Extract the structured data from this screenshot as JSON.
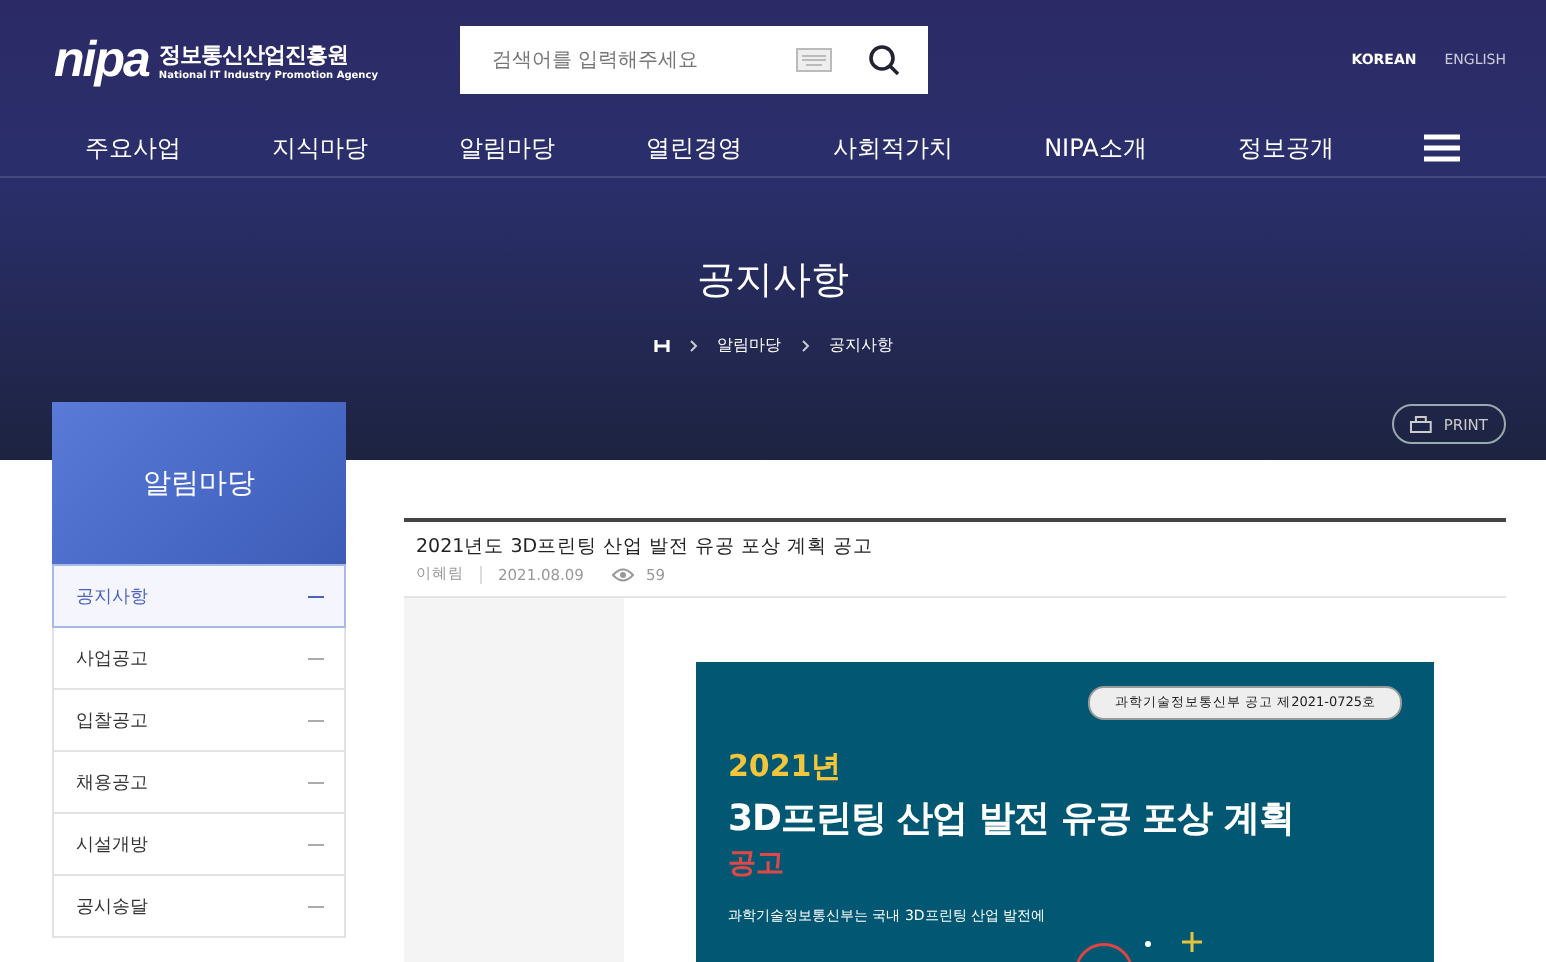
{
  "logo": {
    "mark": "nipa",
    "name": "정보통신산업진흥원",
    "subtitle": "National IT Industry Promotion Agency"
  },
  "search": {
    "placeholder": "검색어를 입력해주세요"
  },
  "languages": [
    {
      "label": "KOREAN",
      "selected": true
    },
    {
      "label": "ENGLISH",
      "selected": false
    }
  ],
  "nav": [
    "주요사업",
    "지식마당",
    "알림마당",
    "열린경영",
    "사회적가치",
    "NIPA소개",
    "정보공개"
  ],
  "page_title": "공지사항",
  "breadcrumb": [
    "알림마당",
    "공지사항"
  ],
  "print_button": "PRINT",
  "sidebar": {
    "title": "알림마당",
    "items": [
      {
        "label": "공지사항",
        "selected": true
      },
      {
        "label": "사업공고",
        "selected": false
      },
      {
        "label": "입찰공고",
        "selected": false
      },
      {
        "label": "채용공고",
        "selected": false
      },
      {
        "label": "시설개방",
        "selected": false
      },
      {
        "label": "공시송달",
        "selected": false
      }
    ]
  },
  "post": {
    "title": "2021년도 3D프린팅 산업 발전 유공 포상 계획 공고",
    "author": "이혜림",
    "date": "2021.08.09",
    "views": "59"
  },
  "poster": {
    "badge": "과학기술정보통신부 공고 제2021-0725호",
    "year": "2021년",
    "headline": "3D프린팅 산업 발전 유공 포상 계획",
    "subhead": "공고",
    "body": "과학기술정보통신부는 국내 3D프린팅 산업 발전에"
  }
}
